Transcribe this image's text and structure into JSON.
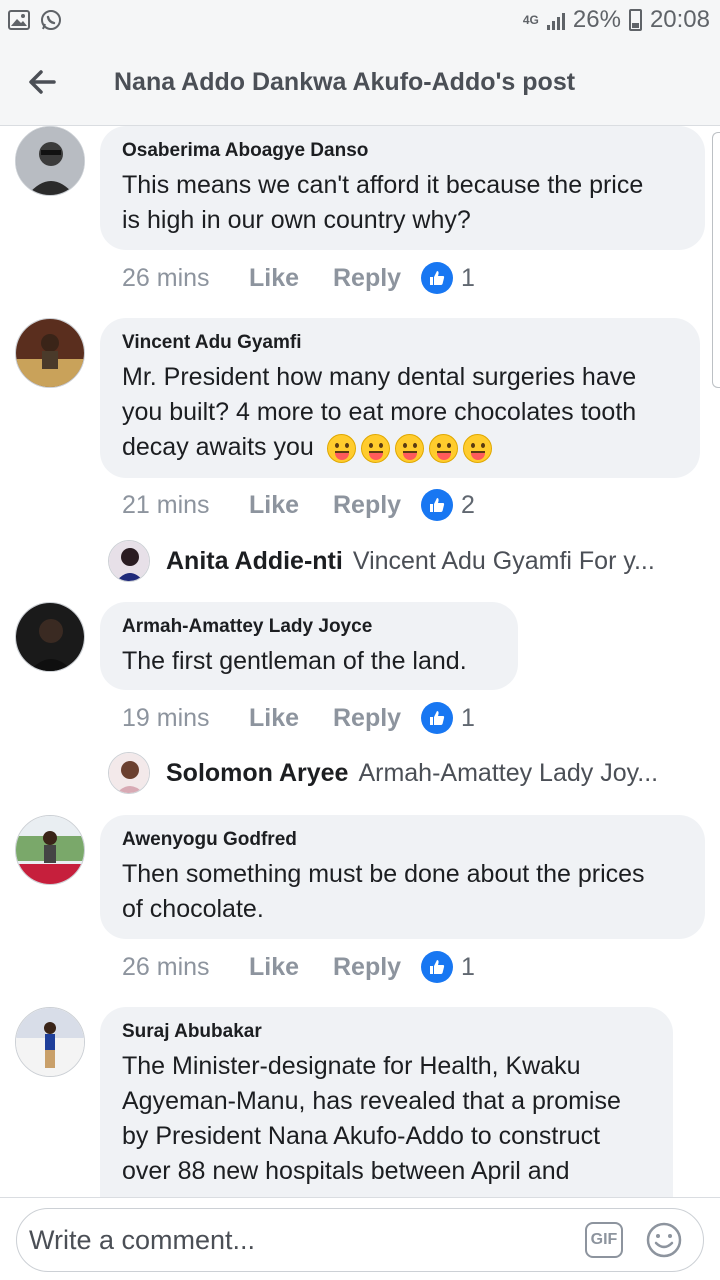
{
  "status_bar": {
    "network": "4G",
    "battery": "26%",
    "time": "20:08"
  },
  "header": {
    "title": "Nana Addo Dankwa Akufo-Addo's post"
  },
  "comments": [
    {
      "author": "Osaberima Aboagye Danso",
      "lines": [
        "This means we can't afford it because the price",
        "is high in our own country why?"
      ],
      "time": "26 mins",
      "like": "Like",
      "reply": "Reply",
      "reactions": "1"
    },
    {
      "author": "Vincent Adu Gyamfi",
      "lines": [
        "Mr. President how many dental surgeries have",
        "you built? 4 more to eat more chocolates tooth",
        "decay awaits you"
      ],
      "time": "21 mins",
      "like": "Like",
      "reply": "Reply",
      "reactions": "2",
      "reply_preview": {
        "name": "Anita Addie-nti",
        "text": "Vincent Adu Gyamfi For y..."
      }
    },
    {
      "author": "Armah-Amattey Lady Joyce",
      "lines": [
        "The first gentleman of the land."
      ],
      "time": "19 mins",
      "like": "Like",
      "reply": "Reply",
      "reactions": "1",
      "reply_preview": {
        "name": "Solomon Aryee",
        "text": "Armah-Amattey Lady Joy..."
      }
    },
    {
      "author": "Awenyogu Godfred",
      "lines": [
        "Then something must be done about the prices",
        "of chocolate."
      ],
      "time": "26 mins",
      "like": "Like",
      "reply": "Reply",
      "reactions": "1"
    },
    {
      "author": "Suraj Abubakar",
      "lines": [
        "The Minister-designate for Health, Kwaku",
        "Agyeman-Manu, has revealed that a promise",
        "by President Nana Akufo-Addo to construct",
        "over 88 new hospitals between April and"
      ]
    }
  ],
  "composer": {
    "placeholder": "Write a comment...",
    "gif_label": "GIF"
  },
  "colors": {
    "accent": "#1877f2",
    "bubble": "#f0f2f5",
    "muted": "#8d949e"
  }
}
